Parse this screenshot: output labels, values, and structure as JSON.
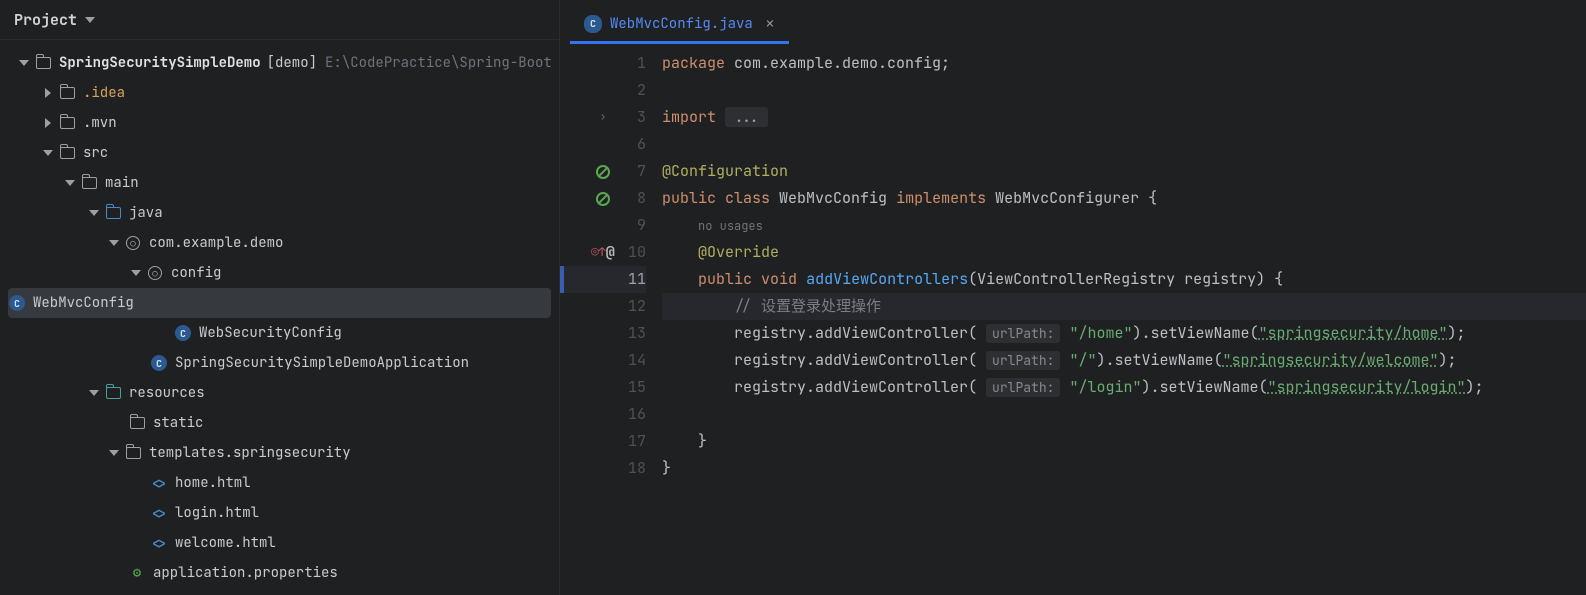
{
  "sidebar": {
    "title": "Project",
    "root": {
      "name": "SpringSecuritySimpleDemo",
      "suffix": "[demo]",
      "path": "E:\\CodePractice\\Spring-Boot"
    },
    "idea": ".idea",
    "mvn": ".mvn",
    "src": "src",
    "main": "main",
    "java": "java",
    "pkg": "com.example.demo",
    "config": "config",
    "webmvc": "WebMvcConfig",
    "websec": "WebSecurityConfig",
    "app": "SpringSecuritySimpleDemoApplication",
    "resources": "resources",
    "static": "static",
    "templates": "templates.springsecurity",
    "home": "home.html",
    "login": "login.html",
    "welcome": "welcome.html",
    "props": "application.properties"
  },
  "tab": {
    "name": "WebMvcConfig.java"
  },
  "gutter": {
    "lines": [
      "1",
      "2",
      "3",
      "6",
      "7",
      "8",
      "9",
      "10",
      "11",
      "12",
      "13",
      "14",
      "15",
      "16",
      "17",
      "18"
    ]
  },
  "code": {
    "pkg_kw": "package",
    "pkg_val": " com.example.demo.config;",
    "import_kw": "import",
    "fold": "...",
    "ann_conf": "@Configuration",
    "pub": "public",
    "cls_kw": "class",
    "cls_name": " WebMvcConfig ",
    "impl_kw": "implements",
    "impl_name": " WebMvcConfigurer {",
    "noUsage": "no usages",
    "ann_ovr": "@Override",
    "void": "void",
    "method": "addViewControllers",
    "method_args": "(ViewControllerRegistry registry) {",
    "cmnt": "// 设置登录处理操作",
    "reg": "registry.addViewController(",
    "hint": "urlPath:",
    "p_home": "\"/home\"",
    "set": ").setViewName(",
    "v_home": "\"springsecurity/home\"",
    "end": ");",
    "p_root": "\"/\"",
    "v_welcome": "\"springsecurity/welcome\"",
    "p_login": "\"/login\"",
    "v_login": "\"springsecurity/login\"",
    "close_brace": "}"
  }
}
